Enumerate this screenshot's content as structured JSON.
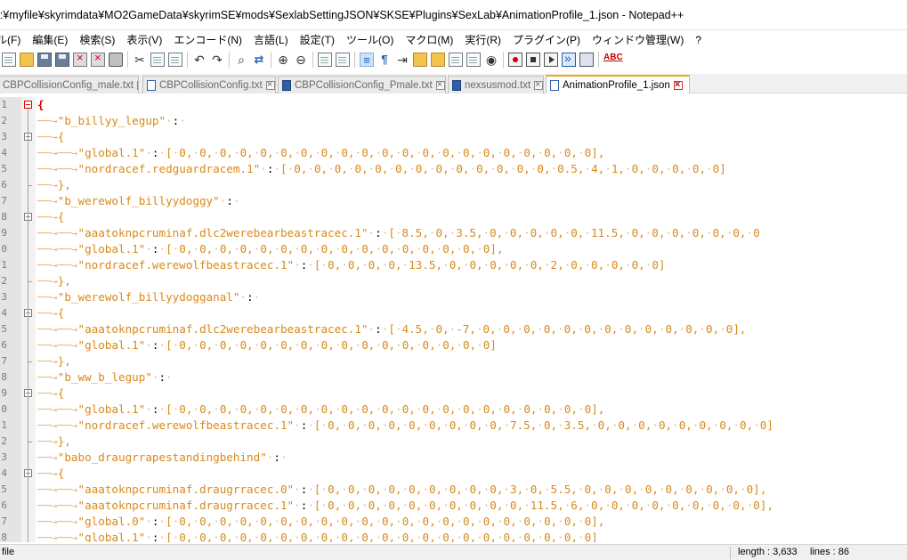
{
  "window": {
    "title": "l:¥myfile¥skyrimdata¥MO2GameData¥skyrimSE¥mods¥SexlabSettingJSON¥SKSE¥Plugins¥SexLab¥AnimationProfile_1.json - Notepad++"
  },
  "menu": {
    "items": [
      "ル(F)",
      "編集(E)",
      "検索(S)",
      "表示(V)",
      "エンコード(N)",
      "言語(L)",
      "設定(T)",
      "ツール(O)",
      "マクロ(M)",
      "実行(R)",
      "プラグイン(P)",
      "ウィンドウ管理(W)",
      "?"
    ]
  },
  "toolbar": {
    "icons": [
      "new-file-icon",
      "open-folder-icon",
      "save-icon",
      "save-all-icon",
      "close-file-icon",
      "close-all-icon",
      "print-icon",
      "cut-icon",
      "copy-icon",
      "paste-icon",
      "undo-icon",
      "redo-icon",
      "find-icon",
      "replace-icon",
      "zoom-in-icon",
      "zoom-out-icon",
      "sync-vertical-icon",
      "sync-horizontal-icon",
      "word-wrap-icon",
      "show-all-characters-icon",
      "indent-guide-icon",
      "user-language-icon",
      "document-map-icon",
      "function-list-icon",
      "folder-workspace-icon",
      "monitoring-icon",
      "record-macro-icon",
      "stop-recording-icon",
      "playback-macro-icon",
      "run-macro-multiple-icon",
      "save-macro-icon",
      "spell-check-icon"
    ]
  },
  "tabs": [
    {
      "label": "CBPCollisionConfig_male.txt",
      "active": false,
      "icon": "doc"
    },
    {
      "label": "CBPCollisionConfig.txt",
      "active": false,
      "icon": "doc"
    },
    {
      "label": "CBPCollisionConfig_Pmale.txt",
      "active": false,
      "icon": "blue"
    },
    {
      "label": "nexsusmod.txt",
      "active": false,
      "icon": "blue"
    },
    {
      "label": "AnimationProfile_1.json",
      "active": true,
      "icon": "doc"
    }
  ],
  "editor": {
    "line_numbers": [
      "1",
      "2",
      "3",
      "4",
      "5",
      "6",
      "7",
      "8",
      "9",
      "0",
      "1",
      "2",
      "3",
      "4",
      "5",
      "6",
      "7",
      "8",
      "9",
      "0",
      "1",
      "2",
      "3",
      "4",
      "5",
      "6",
      "7",
      "8"
    ],
    "lines": [
      "{",
      "→\"b_billyy_legup\"·:·",
      "→{",
      "→→\"global.1\"·:·[·0,·0,·0,·0,·0,·0,·0,·0,·0,·0,·0,·0,·0,·0,·0,·0,·0,·0,·0,·0,·0],",
      "→→\"nordracef.redguardracem.1\"·:·[·0,·0,·0,·0,·0,·0,·0,·0,·0,·0,·0,·0,·0,·0.5,·4,·1,·0,·0,·0,·0,·0]",
      "→},",
      "→\"b_werewolf_billyydoggy\"·:·",
      "→{",
      "→→\"aaatoknpcruminaf.dlc2werebearbeastracec.1\"·:·[·8.5,·0,·3.5,·0,·0,·0,·0,·0,·11.5,·0,·0,·0,·0,·0,·0,·0",
      "→→\"global.1\"·:·[·0,·0,·0,·0,·0,·0,·0,·0,·0,·0,·0,·0,·0,·0,·0,·0],",
      "→→\"nordracef.werewolfbeastracec.1\"·:·[·0,·0,·0,·0,·13.5,·0,·0,·0,·0,·0,·2,·0,·0,·0,·0,·0]",
      "→},",
      "→\"b_werewolf_billyydogganal\"·:·",
      "→{",
      "→→\"aaatoknpcruminaf.dlc2werebearbeastracec.1\"·:·[·4.5,·0,·-7,·0,·0,·0,·0,·0,·0,·0,·0,·0,·0,·0,·0,·0],",
      "→→\"global.1\"·:·[·0,·0,·0,·0,·0,·0,·0,·0,·0,·0,·0,·0,·0,·0,·0,·0]",
      "→},",
      "→\"b_ww_b_legup\"·:·",
      "→{",
      "→→\"global.1\"·:·[·0,·0,·0,·0,·0,·0,·0,·0,·0,·0,·0,·0,·0,·0,·0,·0,·0,·0,·0,·0,·0],",
      "→→\"nordracef.werewolfbeastracec.1\"·:·[·0,·0,·0,·0,·0,·0,·0,·0,·0,·7.5,·0,·3.5,·0,·0,·0,·0,·0,·0,·0,·0,·0]",
      "→},",
      "→\"babo_draugrrapestandingbehind\"·:·",
      "→{",
      "→→\"aaatoknpcruminaf.draugrracec.0\"·:·[·0,·0,·0,·0,·0,·0,·0,·0,·0,·3,·0,·5.5,·0,·0,·0,·0,·0,·0,·0,·0,·0],",
      "→→\"aaatoknpcruminaf.draugrracec.1\"·:·[·0,·0,·0,·0,·0,·0,·0,·0,·0,·0,·11.5,·6,·0,·0,·0,·0,·0,·0,·0,·0,·0],",
      "→→\"global.0\"·:·[·0,·0,·0,·0,·0,·0,·0,·0,·0,·0,·0,·0,·0,·0,·0,·0,·0,·0,·0,·0,·0],",
      "→→\"global.1\"·:·[·0,·0,·0,·0,·0,·0,·0,·0,·0,·0,·0,·0,·0,·0,·0,·0,·0,·0,·0,·0,·0]"
    ]
  },
  "statusbar": {
    "file_type": "file",
    "length": "length : 3,633",
    "lines": "lines : 86"
  },
  "colors": {
    "string": "#d9891a",
    "arrow": "#e8b880",
    "fold_open": "#e00000",
    "active_tab_accent": "#f5a623",
    "gutter": "#e4e4e4"
  }
}
